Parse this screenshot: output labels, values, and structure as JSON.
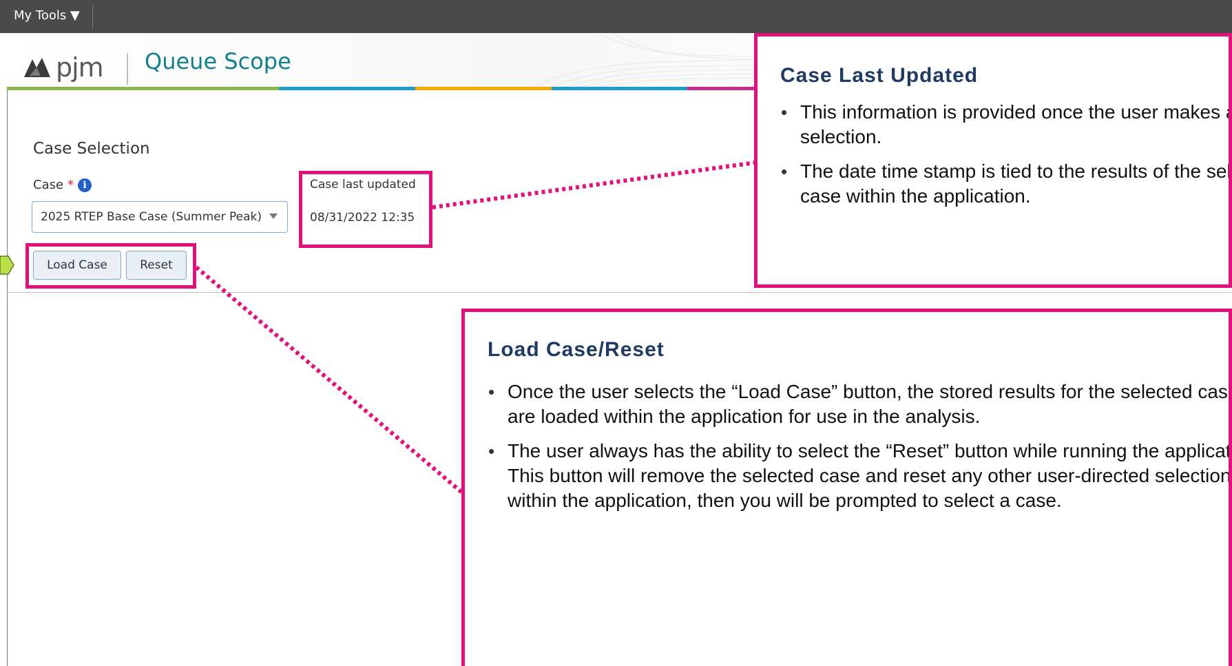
{
  "topbar": {
    "my_tools": "My Tools ▼"
  },
  "header": {
    "logo_text": "pjm",
    "app_title": "Queue Scope"
  },
  "colors": {
    "accent_magenta": "#e0117a",
    "title_teal": "#13808c",
    "callout_heading": "#1f3a63",
    "strip": [
      "#8ab848",
      "#8ab848",
      "#1a9bcc",
      "#f2a900",
      "#1a9bcc",
      "#ca2a8a",
      "#8ab848",
      "#1a9bcc",
      "#f2a900"
    ]
  },
  "form": {
    "section_title": "Case Selection",
    "case_label": "Case",
    "required_mark": "*",
    "info_icon_glyph": "i",
    "case_value": "2025 RTEP Base Case (Summer Peak)",
    "updated_label": "Case last updated",
    "updated_value": "08/31/2022 12:35",
    "load_button": "Load Case",
    "reset_button": "Reset"
  },
  "callouts": {
    "updated": {
      "heading": "Case Last Updated",
      "bullets": [
        "This information is provided once the user makes a case selection.",
        "The date time stamp is tied to the results of the selected case within the application."
      ]
    },
    "load_reset": {
      "heading": "Load Case/Reset",
      "bullets": [
        "Once the user selects the “Load Case” button, the stored results for the selected case are loaded within the application for use in the analysis.",
        "The user always has the ability to select the “Reset” button while running the application. This button will remove the selected case and reset any other user-directed selections within the application, then you will be prompted to select a case."
      ]
    }
  }
}
